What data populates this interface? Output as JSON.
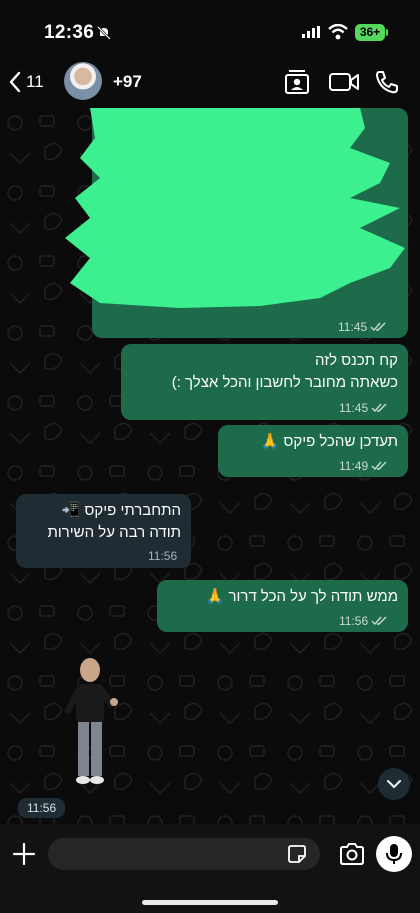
{
  "status_bar": {
    "time": "12:36",
    "battery": "36+"
  },
  "header": {
    "back_count": "11",
    "contact_name": "+97"
  },
  "messages": [
    {
      "direction": "out",
      "text": "",
      "time": "11:45",
      "redacted": true
    },
    {
      "direction": "out",
      "text": "קח תכנס לזה\nכשאתה מחובר לחשבון והכל אצלך :)",
      "time": "11:45"
    },
    {
      "direction": "out",
      "text": "תעדכן שהכל פיקס 🙏",
      "time": "11:49"
    },
    {
      "direction": "in",
      "text": "התחברתי פיקס 📲\nתודה רבה על השירות",
      "time": "11:56"
    },
    {
      "direction": "out",
      "text": "ממש תודה לך על הכל דרור 🙏",
      "time": "11:56"
    }
  ],
  "sticker": {
    "time": "11:56"
  },
  "input": {
    "placeholder": "",
    "value": ""
  },
  "colors": {
    "outgoing": "#1e6b4c",
    "incoming": "#1f2c34",
    "scribble": "#3df08f",
    "background": "#0b0b0b"
  }
}
